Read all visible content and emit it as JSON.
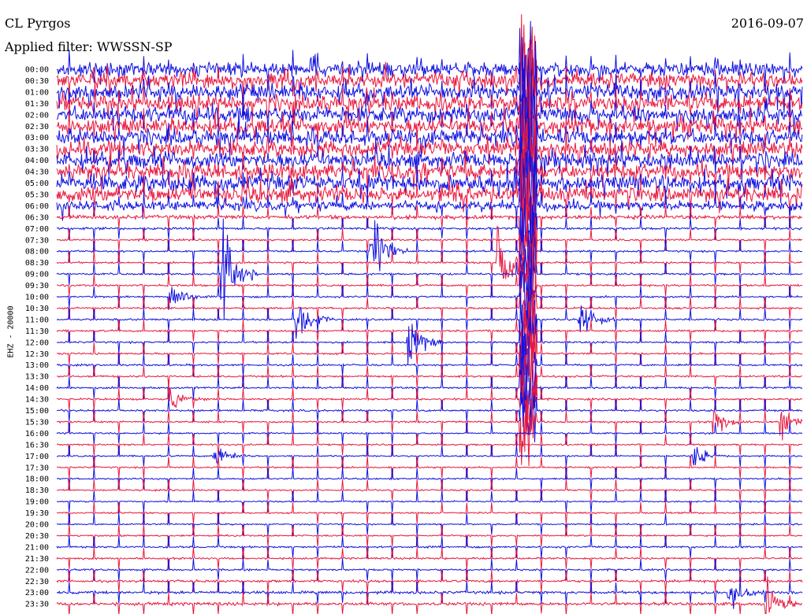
{
  "header": {
    "station": "CL Pyrgos",
    "filter": "Applied filter: WWSSN-SP",
    "date": "2016-09-07"
  },
  "chart_data": {
    "type": "line",
    "title": "CL Pyrgos",
    "subtitle": "Applied filter: WWSSN-SP",
    "ylabel": "EHZ - 20000",
    "series_colors": [
      "#1010e0",
      "#e8183e"
    ],
    "rows": [
      "00:00",
      "00:30",
      "01:00",
      "01:30",
      "02:00",
      "02:30",
      "03:00",
      "03:30",
      "04:00",
      "04:30",
      "05:00",
      "05:30",
      "06:00",
      "06:30",
      "07:00",
      "07:30",
      "08:00",
      "08:30",
      "09:00",
      "09:30",
      "10:00",
      "10:30",
      "11:00",
      "11:30",
      "12:00",
      "12:30",
      "13:00",
      "13:30",
      "14:00",
      "14:30",
      "15:00",
      "15:30",
      "16:00",
      "16:30",
      "17:00",
      "17:30",
      "18:00",
      "18:30",
      "19:00",
      "19:30",
      "20:00",
      "20:30",
      "21:00",
      "21:30",
      "22:00",
      "22:30",
      "23:00",
      "23:30"
    ],
    "noise_level": [
      0.9,
      0.9,
      1,
      1,
      1,
      1,
      1,
      1,
      1,
      1,
      1,
      1,
      0.6,
      0.25,
      0.15,
      0.12,
      0.12,
      0.12,
      0.12,
      0.12,
      0.12,
      0.12,
      0.12,
      0.12,
      0.12,
      0.12,
      0.12,
      0.12,
      0.12,
      0.12,
      0.12,
      0.12,
      0.1,
      0.1,
      0.1,
      0.1,
      0.1,
      0.1,
      0.1,
      0.1,
      0.1,
      0.1,
      0.12,
      0.12,
      0.12,
      0.15,
      0.18,
      0.2
    ],
    "events": [
      {
        "row": 16,
        "t": 0.42,
        "amp": 1.6
      },
      {
        "row": 17,
        "t": 0.59,
        "amp": 1.8
      },
      {
        "row": 18,
        "t": 0.22,
        "amp": 1.8
      },
      {
        "row": 22,
        "t": 0.32,
        "amp": 1.1
      },
      {
        "row": 24,
        "t": 0.47,
        "amp": 1.0
      },
      {
        "row": 22,
        "t": 0.7,
        "amp": 0.8
      },
      {
        "row": 20,
        "t": 0.15,
        "amp": 0.5
      },
      {
        "row": 29,
        "t": 0.15,
        "amp": 0.4
      },
      {
        "row": 31,
        "t": 0.88,
        "amp": 0.45
      },
      {
        "row": 31,
        "t": 0.97,
        "amp": 0.6
      },
      {
        "row": 34,
        "t": 0.21,
        "amp": 0.5
      },
      {
        "row": 34,
        "t": 0.85,
        "amp": 0.45
      },
      {
        "row": 46,
        "t": 0.9,
        "amp": 0.6
      },
      {
        "row": 47,
        "t": 0.95,
        "amp": 0.8
      }
    ],
    "big_quake": {
      "t": 0.632,
      "row_start": 0,
      "row_end": 31
    },
    "minute_marks": true
  }
}
